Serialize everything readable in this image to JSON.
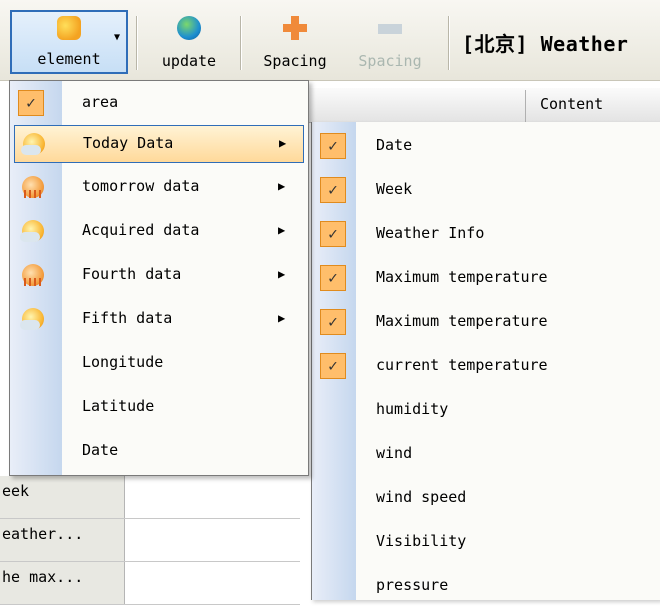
{
  "toolbar": {
    "element_label": "element",
    "update_label": "update",
    "spacing_label": "Spacing",
    "spacing_disabled_label": "Spacing",
    "title": "[北京] Weather"
  },
  "grid": {
    "content_header": "Content",
    "rows": [
      "eek",
      "eather...",
      "he max..."
    ]
  },
  "menu": {
    "items": [
      {
        "label": "area",
        "icon": "check-icon",
        "checked": true
      },
      {
        "label": "Today Data",
        "icon": "sun-cloud-icon",
        "submenu": true,
        "highlighted": true
      },
      {
        "label": "tomorrow data",
        "icon": "storm-icon",
        "submenu": true
      },
      {
        "label": "Acquired data",
        "icon": "sun-cloud-icon",
        "submenu": true
      },
      {
        "label": "Fourth data",
        "icon": "storm-icon",
        "submenu": true
      },
      {
        "label": "Fifth data",
        "icon": "sun-cloud-icon",
        "submenu": true
      },
      {
        "label": "Longitude"
      },
      {
        "label": "Latitude"
      },
      {
        "label": "Date"
      }
    ]
  },
  "submenu": {
    "items": [
      {
        "label": "Date",
        "checked": true
      },
      {
        "label": "Week",
        "checked": true
      },
      {
        "label": "Weather Info",
        "checked": true
      },
      {
        "label": "Maximum temperature",
        "checked": true
      },
      {
        "label": "Maximum temperature",
        "checked": true
      },
      {
        "label": "current temperature",
        "checked": true
      },
      {
        "label": "humidity"
      },
      {
        "label": "wind"
      },
      {
        "label": "wind speed"
      },
      {
        "label": "Visibility"
      },
      {
        "label": "pressure"
      }
    ]
  },
  "colors": {
    "highlight_border": "#2f6db8",
    "check_fill": "#ffbe6b",
    "check_border": "#e08b1e"
  }
}
